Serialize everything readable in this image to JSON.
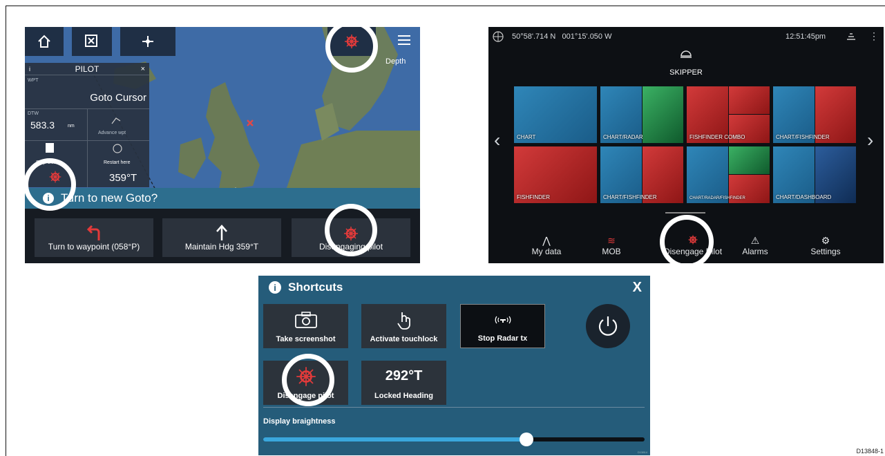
{
  "reference": "D13848-1",
  "chart_screen": {
    "depth_label": "Depth",
    "pilot": {
      "title": "PILOT",
      "info": "i",
      "close": "×",
      "wpt_label": "WPT",
      "wpt_value": "Goto Cursor",
      "dtw_label": "DTW",
      "dtw_value": "583.3",
      "dtw_unit": "nm",
      "advance_label": "Advance wpt",
      "stop_label": "Stop Goto",
      "restart_label": "Restart here",
      "heading_value": "359°T"
    },
    "prompt": "Turn to new Goto?",
    "actions": [
      "Turn to waypoint (058°P)",
      "Maintain Hdg 359°T",
      "Disengaging pilot"
    ]
  },
  "home_screen": {
    "position": "50°58'.714 N   001°15'.050 W",
    "time": "12:51:45pm",
    "profile": "SKIPPER",
    "tiles": [
      "CHART",
      "CHART/RADAR",
      "FISHFINDER COMBO",
      "CHART/FISHFINDER",
      "FISHFINDER",
      "CHART/FISHFINDER",
      "CHART/RADAR/FISHFINDER",
      "CHART/DASHBOARD"
    ],
    "dock": [
      "My data",
      "MOB",
      "Disengage Pilot",
      "Alarms",
      "Settings"
    ]
  },
  "shortcuts": {
    "title": "Shortcuts",
    "close": "X",
    "items": [
      "Take screenshot",
      "Activate touchlock",
      "Stop Radar tx",
      "Disengage pilot"
    ],
    "heading_value": "292°T",
    "heading_label": "Locked Heading",
    "brightness_label": "Display braightness",
    "brightness": 0.69,
    "footnote": "D13814"
  },
  "colors": {
    "accent": "#3aa7dd",
    "alert": "#e23a3a",
    "panel": "#255c7a"
  }
}
